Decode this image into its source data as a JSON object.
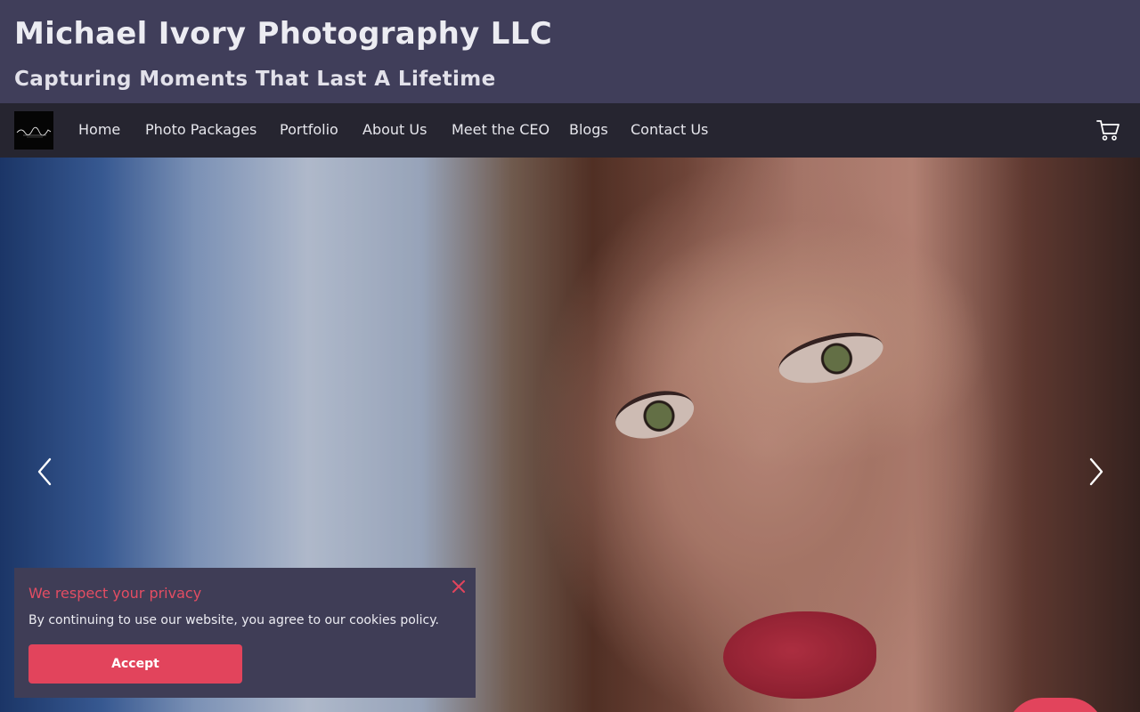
{
  "header": {
    "title": "Michael Ivory Photography LLC",
    "tagline": "Capturing Moments That Last A Lifetime"
  },
  "nav": {
    "logo_icon": "business-logo",
    "items": [
      {
        "label": "Home"
      },
      {
        "label": "Photo Packages"
      },
      {
        "label": "Portfolio"
      },
      {
        "label": "About Us"
      },
      {
        "label": "Meet the CEO"
      },
      {
        "label": "Blogs"
      },
      {
        "label": "Contact Us"
      }
    ],
    "cart_icon": "shopping-cart-icon"
  },
  "hero": {
    "prev_icon": "chevron-left-icon",
    "next_icon": "chevron-right-icon"
  },
  "cookie": {
    "title": "We respect your privacy",
    "message": "By continuing to use our website, you agree to our cookies policy.",
    "accept_label": "Accept",
    "close_icon": "close-icon"
  },
  "colors": {
    "header_bg": "#403e5a",
    "nav_bg": "#262530",
    "accent": "#e2445c",
    "banner_bg": "#3f3d56"
  }
}
